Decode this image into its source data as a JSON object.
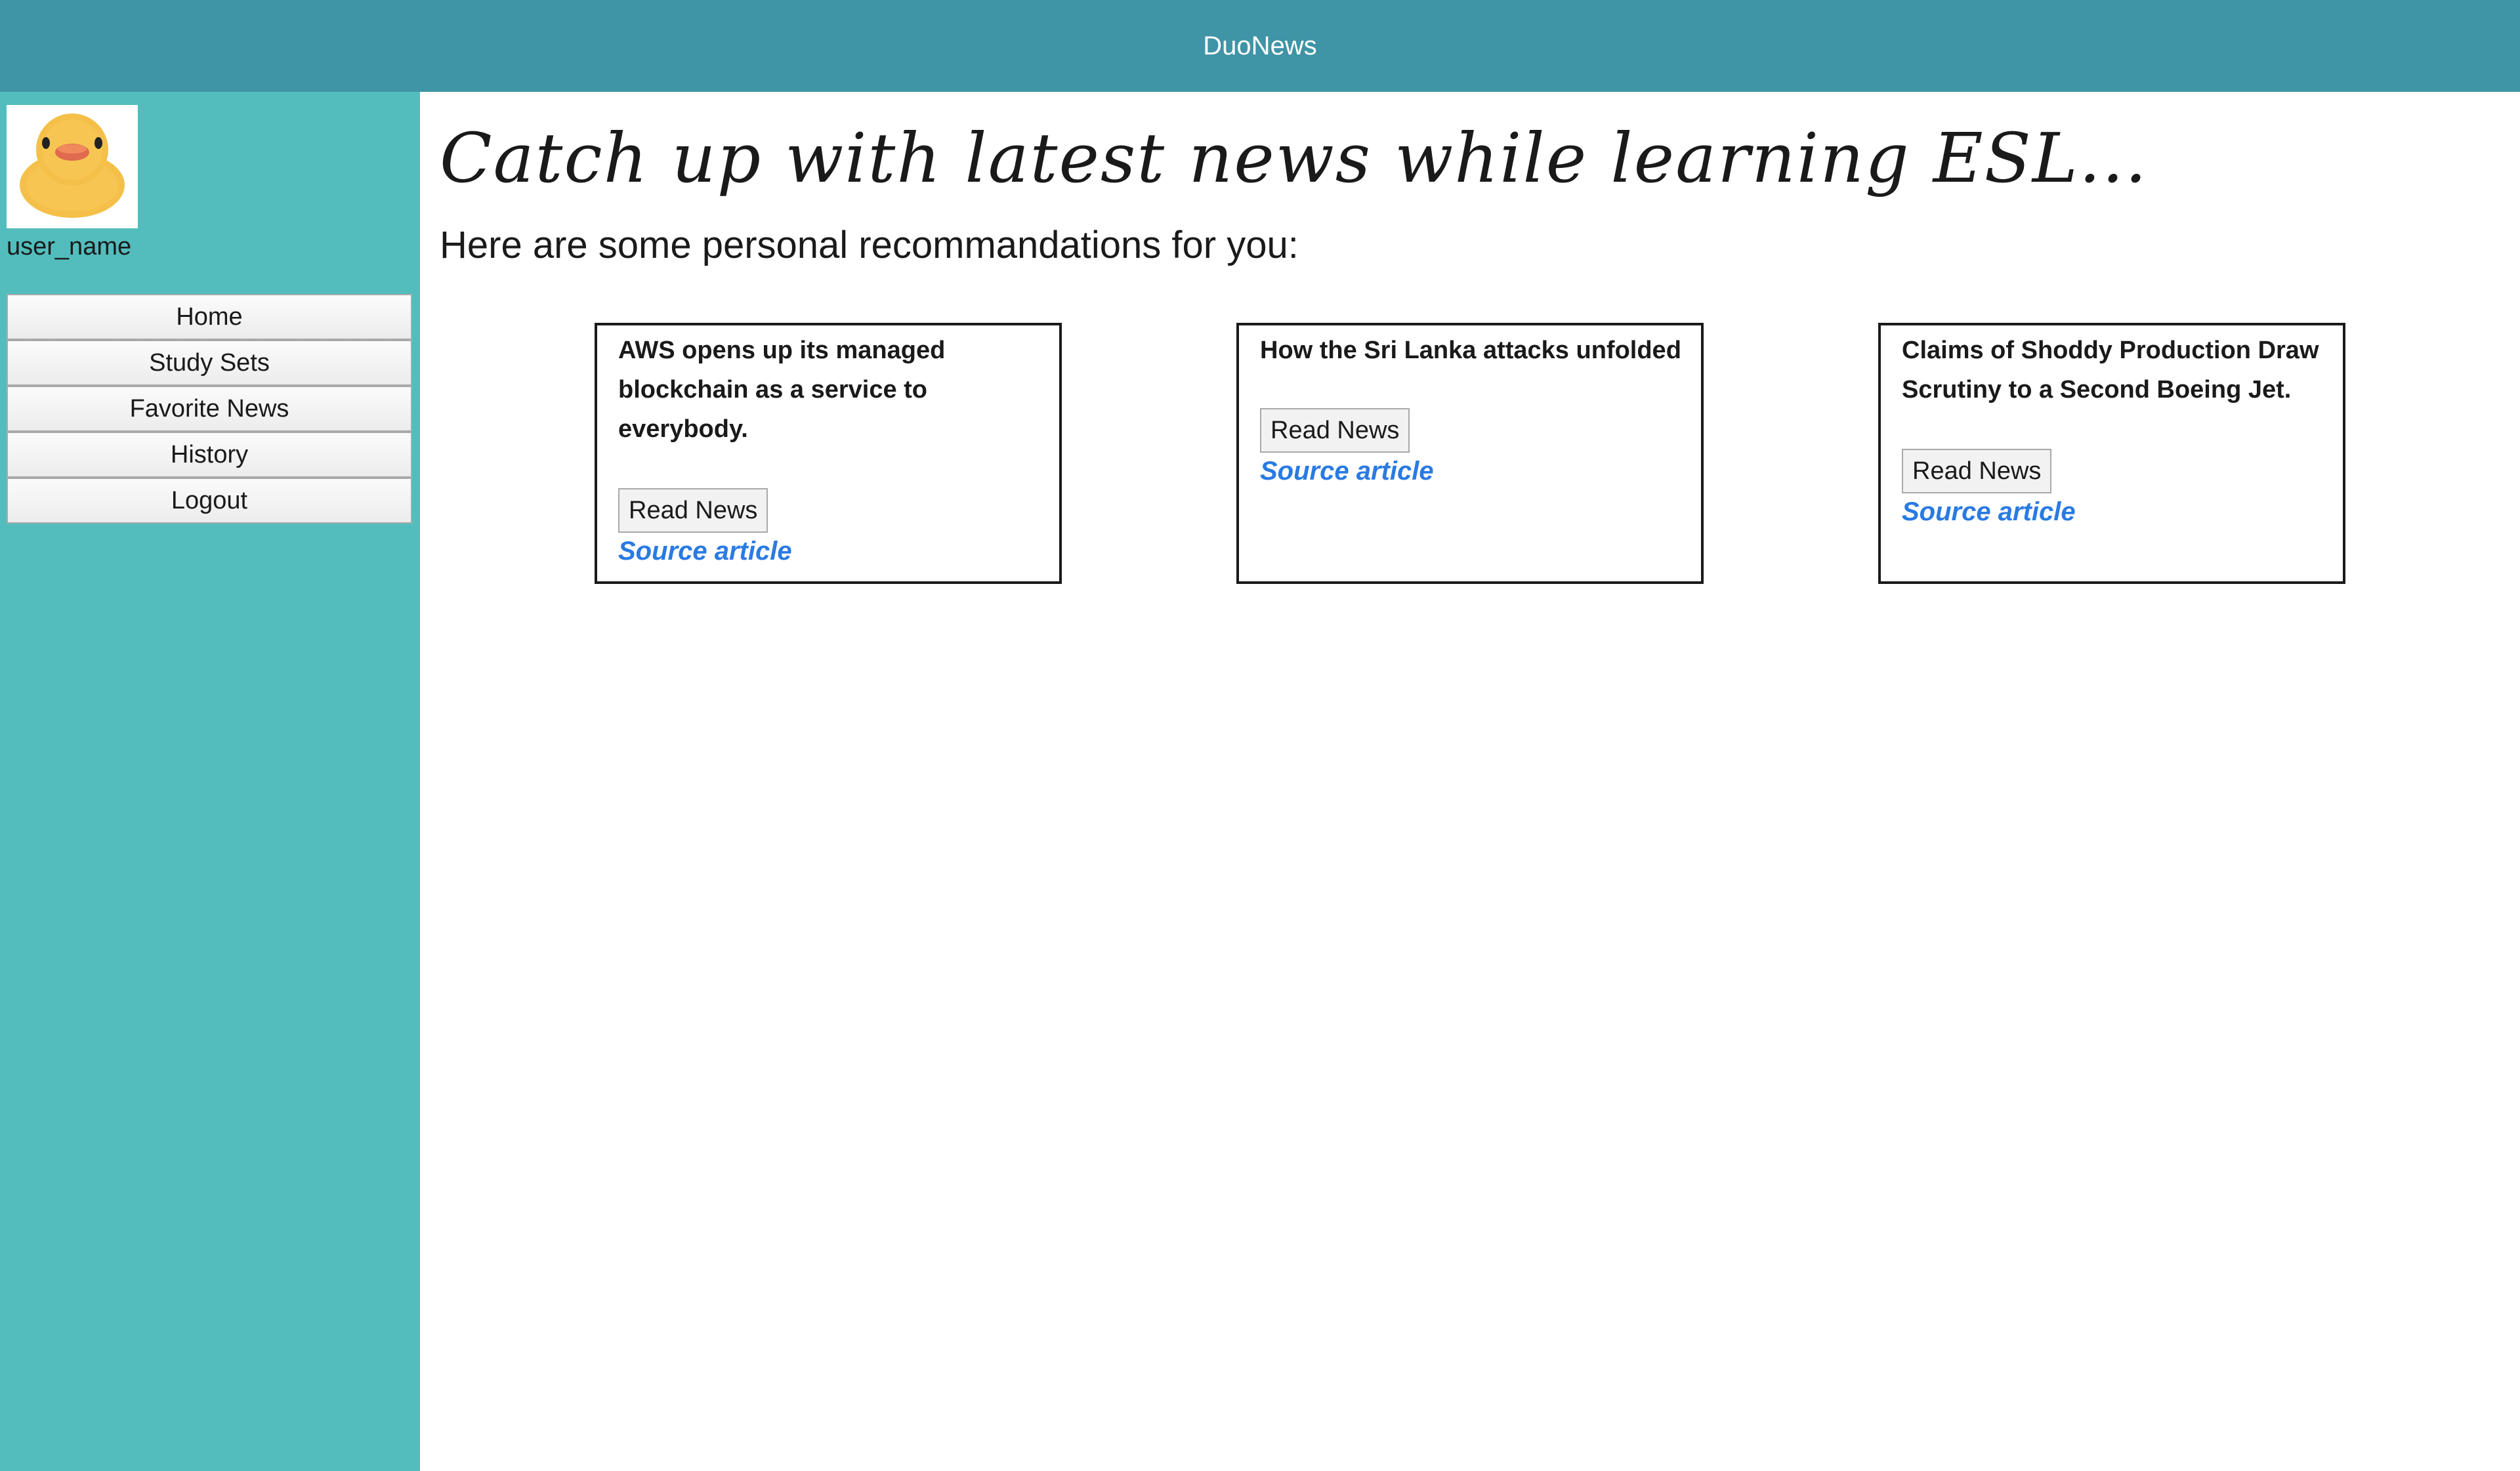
{
  "header": {
    "app_title": "DuoNews"
  },
  "sidebar": {
    "avatar_icon": "rubber-duck-icon",
    "username": "user_name",
    "items": [
      {
        "label": "Home"
      },
      {
        "label": "Study Sets"
      },
      {
        "label": "Favorite News"
      },
      {
        "label": "History"
      },
      {
        "label": "Logout"
      }
    ]
  },
  "main": {
    "headline": "Catch up with latest news while learning ESL...",
    "subheading": "Here are some personal recommandations for you:",
    "cards": [
      {
        "title": "AWS opens up its managed blockchain as a service to everybody.",
        "button_label": "Read News",
        "link_label": "Source article"
      },
      {
        "title": "How the Sri Lanka attacks unfolded",
        "button_label": "Read News",
        "link_label": "Source article"
      },
      {
        "title": "Claims of Shoddy Production Draw Scrutiny to a Second Boeing Jet.",
        "button_label": "Read News",
        "link_label": "Source article"
      }
    ]
  },
  "colors": {
    "topbar": "#3f94a6",
    "sidebar": "#53bdbd",
    "link": "#2a7ae2"
  }
}
